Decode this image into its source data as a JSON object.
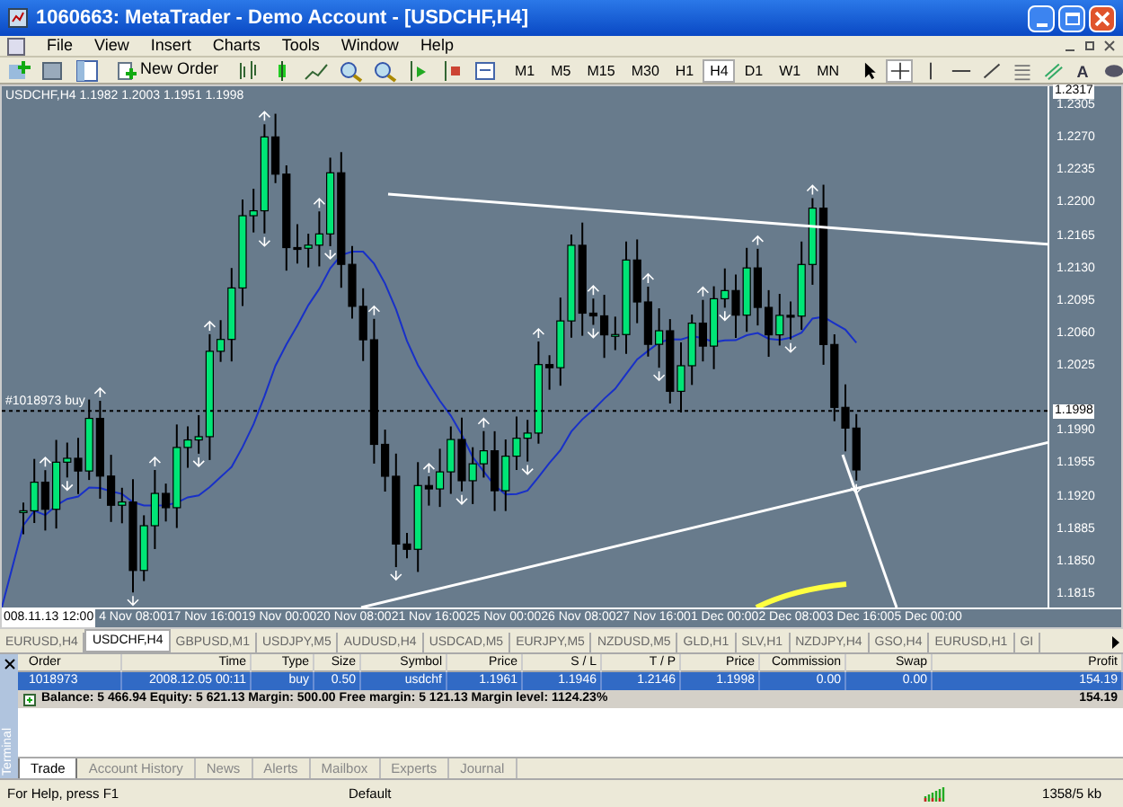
{
  "window": {
    "title": "1060663: MetaTrader - Demo Account - [USDCHF,H4]"
  },
  "menu": [
    "File",
    "View",
    "Insert",
    "Charts",
    "Tools",
    "Window",
    "Help"
  ],
  "toolbar": {
    "new_order": "New Order",
    "timeframes": [
      {
        "label": "M1",
        "selected": false
      },
      {
        "label": "M5",
        "selected": false
      },
      {
        "label": "M15",
        "selected": false
      },
      {
        "label": "M30",
        "selected": false
      },
      {
        "label": "H1",
        "selected": false
      },
      {
        "label": "H4",
        "selected": true
      },
      {
        "label": "D1",
        "selected": false
      },
      {
        "label": "W1",
        "selected": false
      },
      {
        "label": "MN",
        "selected": false
      }
    ],
    "tools": [
      {
        "kind": "cursor",
        "selected": false
      },
      {
        "kind": "crosshair",
        "selected": true
      },
      {
        "kind": "vertical",
        "selected": false
      },
      {
        "kind": "horizontal",
        "selected": false
      },
      {
        "kind": "trend",
        "selected": false
      },
      {
        "kind": "fibo",
        "selected": false
      },
      {
        "kind": "channel",
        "selected": false
      },
      {
        "kind": "text",
        "label": "A",
        "selected": false
      },
      {
        "kind": "label",
        "selected": false
      }
    ]
  },
  "chart": {
    "symbol_label": "USDCHF,H4  1.1982 1.2003 1.1951 1.1998",
    "order_label": "#1018973 buy",
    "top_price": "1.2317",
    "current_price": "1.1998",
    "price_ticks": [
      "1.2305",
      "1.2270",
      "1.2235",
      "1.2200",
      "1.2165",
      "1.2130",
      "1.2095",
      "1.2060",
      "1.2025",
      "1.1990",
      "1.1955",
      "1.1920",
      "1.1885",
      "1.1850",
      "1.1815"
    ],
    "time_cursor": "008.11.13 12:00",
    "time_ticks": [
      "4 Nov 08:00",
      "17 Nov 16:00",
      "19 Nov 00:00",
      "20 Nov 08:00",
      "21 Nov 16:00",
      "25 Nov 00:00",
      "26 Nov 08:00",
      "27 Nov 16:00",
      "1 Dec 00:00",
      "2 Dec 08:00",
      "3 Dec 16:00",
      "5 Dec 00:00"
    ]
  },
  "symbol_tabs": [
    {
      "label": "EURUSD,H4",
      "selected": false
    },
    {
      "label": "USDCHF,H4",
      "selected": true
    },
    {
      "label": "GBPUSD,M1",
      "selected": false
    },
    {
      "label": "USDJPY,M5",
      "selected": false
    },
    {
      "label": "AUDUSD,H4",
      "selected": false
    },
    {
      "label": "USDCAD,M5",
      "selected": false
    },
    {
      "label": "EURJPY,M5",
      "selected": false
    },
    {
      "label": "NZDUSD,M5",
      "selected": false
    },
    {
      "label": "GLD,H1",
      "selected": false
    },
    {
      "label": "SLV,H1",
      "selected": false
    },
    {
      "label": "NZDJPY,H4",
      "selected": false
    },
    {
      "label": "GSO,H4",
      "selected": false
    },
    {
      "label": "EURUSD,H1",
      "selected": false
    },
    {
      "label": "GI",
      "selected": false
    }
  ],
  "terminal": {
    "side_label": "Terminal",
    "columns": [
      "Order",
      "Time",
      "Type",
      "Size",
      "Symbol",
      "Price",
      "S / L",
      "T / P",
      "Price",
      "Commission",
      "Swap",
      "Profit"
    ],
    "rows": [
      {
        "selected": true,
        "cells": [
          "1018973",
          "2008.12.05 00:11",
          "buy",
          "0.50",
          "usdchf",
          "1.1961",
          "1.1946",
          "1.2146",
          "1.1998",
          "0.00",
          "0.00",
          "154.19"
        ]
      }
    ],
    "summary": {
      "text": "Balance: 5 466.94  Equity: 5 621.13  Margin: 500.00  Free margin: 5 121.13  Margin level: 1124.23%",
      "profit": "154.19"
    },
    "tabs": [
      {
        "label": "Trade",
        "selected": true
      },
      {
        "label": "Account History",
        "selected": false
      },
      {
        "label": "News",
        "selected": false
      },
      {
        "label": "Alerts",
        "selected": false
      },
      {
        "label": "Mailbox",
        "selected": false
      },
      {
        "label": "Experts",
        "selected": false
      },
      {
        "label": "Journal",
        "selected": false
      }
    ]
  },
  "status_bar": {
    "help": "For Help, press F1",
    "profile": "Default",
    "traffic": "1358/5 kb"
  }
}
